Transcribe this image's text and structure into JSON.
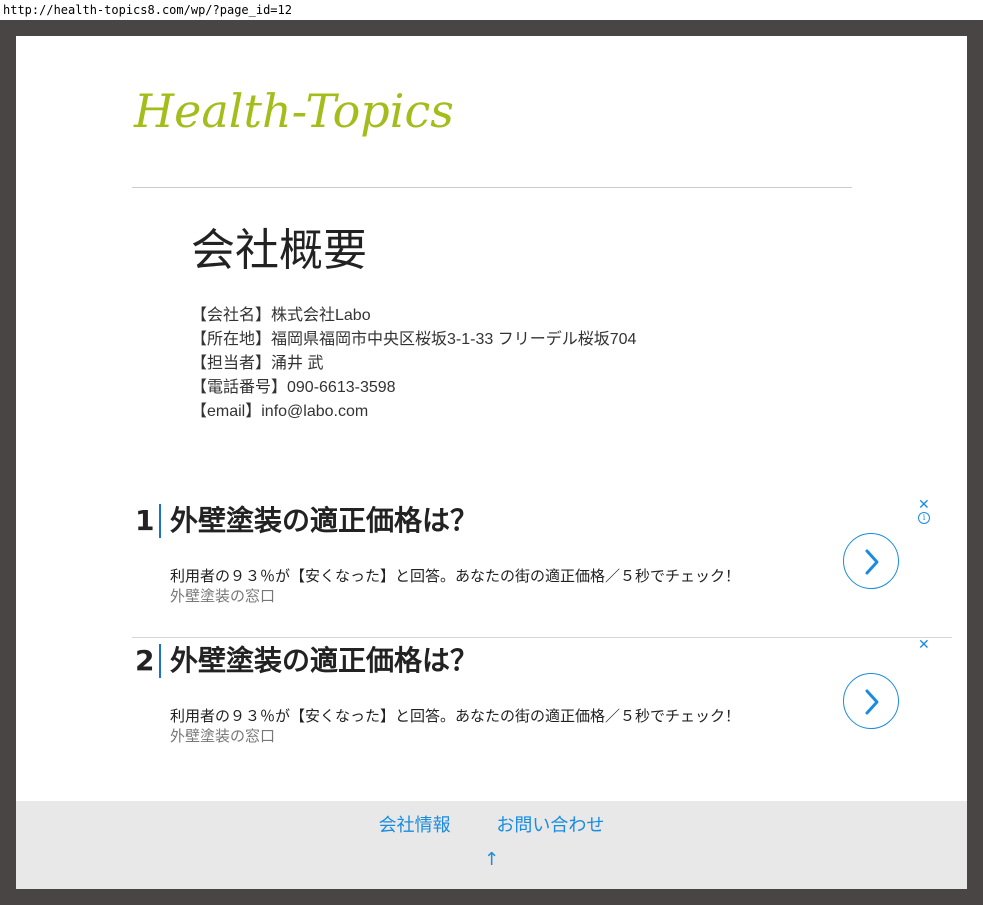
{
  "browser": {
    "url": "http://health-topics8.com/wp/?page_id=12"
  },
  "site": {
    "title": "Health-Topics",
    "accent_color": "#a4bd1a"
  },
  "page": {
    "title": "会社概要"
  },
  "company_info": [
    "【会社名】株式会社Labo",
    "【所在地】福岡県福岡市中央区桜坂3-1-33 フリーデル桜坂704",
    "【担当者】涌井 武",
    "【電話番号】090-6613-3598",
    "【email】info@labo.com"
  ],
  "ads": [
    {
      "rank": "1",
      "headline": "外壁塗装の適正価格は？",
      "description": "利用者の９３％が【安くなった】と回答。あなたの街の適正価格／５秒でチェック！",
      "source": "外壁塗装の窓口",
      "close_icon": "close-icon",
      "info_icon": "info-icon",
      "arrow_icon": "chevron-right-icon"
    },
    {
      "rank": "2",
      "headline": "外壁塗装の適正価格は？",
      "description": "利用者の９３％が【安くなった】と回答。あなたの街の適正価格／５秒でチェック！",
      "source": "外壁塗装の窓口",
      "close_icon": "close-icon",
      "arrow_icon": "chevron-right-icon"
    }
  ],
  "ad_controls": {
    "close_glyph": "✕",
    "info_glyph": "i"
  },
  "footer": {
    "links": [
      "会社情報",
      "お問い合わせ"
    ],
    "back_to_top": "↑",
    "link_color": "#1a8ce0"
  }
}
